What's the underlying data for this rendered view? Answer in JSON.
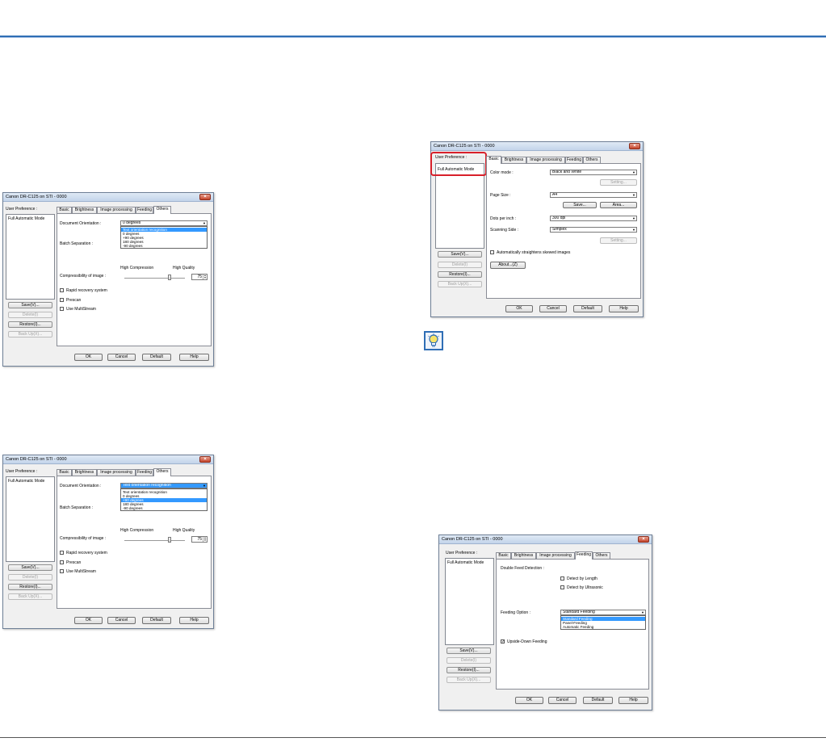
{
  "dialog": {
    "title": "Canon DR-C125 on STI - 0000",
    "close_symbol": "×",
    "user_preference_label": "User Preference :",
    "preference_item": "Full Automatic Mode",
    "side_buttons": [
      "Save(V)...",
      "Delete(I)",
      "Restore(I)...",
      "Back Up(X)..."
    ],
    "tabs": [
      "Basic",
      "Brightness",
      "Image processing",
      "Feeding",
      "Others"
    ],
    "bottom_buttons": [
      "OK",
      "Cancel",
      "Default",
      "Help"
    ]
  },
  "others_tab": {
    "document_orientation_label": "Document Orientation :",
    "batch_separation_label": "Batch Separation :",
    "high_compression_label": "High Compression",
    "high_quality_label": "High Quality",
    "compressibility_label": "Compressibility of image :",
    "compressibility_value": "75",
    "compressibility_level": 0.75,
    "checkboxes": [
      "Rapid recovery system",
      "Prescan",
      "Use MultiStream"
    ],
    "orientation_options": [
      "Text orientation recognition",
      "0 degrees",
      "+90 degrees",
      "180 degrees",
      "-90 degrees"
    ]
  },
  "dialog_a": {
    "combo_value": "0 degrees",
    "highlighted_option": "Text orientation recognition"
  },
  "dialog_b": {
    "combo_value": "Text orientation recognition",
    "highlighted_option": "+90 degrees"
  },
  "basic_tab": {
    "color_mode_label": "Color mode :",
    "color_mode_value": "Black and White",
    "setting_button": "Setting...",
    "page_size_label": "Page Size :",
    "page_size_value": "A4",
    "save_button": "Save...",
    "area_button": "Area...",
    "dots_per_inch_label": "Dots per inch :",
    "dots_per_inch_value": "300 dpi",
    "scanning_side_label": "Scanning Side :",
    "scanning_side_value": "Simplex",
    "setting_button_2": "Setting...",
    "straighten_label": "Automatically straightens skewed images",
    "about_button": "About...(Z)"
  },
  "feeding_tab": {
    "double_feed_label": "Double Feed Detection :",
    "detect_length": "Detect by Length",
    "detect_ultrasonic": "Detect by Ultrasonic",
    "feeding_option_label": "Feeding Option :",
    "feeding_value": "Standard Feeding",
    "feeding_options": [
      "Standard Feeding",
      "Panel-Feeding",
      "Automatic Feeding"
    ],
    "highlighted_option": "Standard Feeding",
    "upside_down": "Upside-Down Feeding",
    "upside_down_checked": true
  },
  "colors": {
    "accent_rule": "#2f6eb5",
    "callout": "#d8202a",
    "selection": "#3399ff"
  },
  "hint_icon": "lightbulb-icon"
}
